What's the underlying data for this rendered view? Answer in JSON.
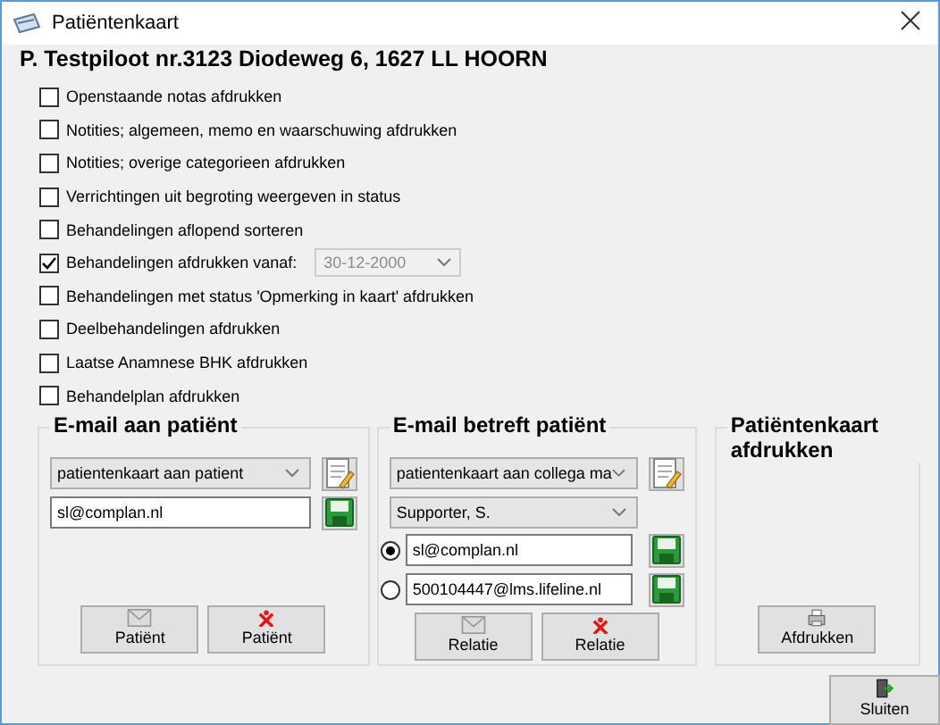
{
  "window": {
    "title": "Patiëntenkaart"
  },
  "header": "P. Testpiloot nr.3123 Diodeweg 6, 1627 LL HOORN",
  "options": [
    {
      "label": "Openstaande notas afdrukken",
      "checked": false
    },
    {
      "label": "Notities; algemeen, memo en waarschuwing afdrukken",
      "checked": false
    },
    {
      "label": "Notities; overige categorieen afdrukken",
      "checked": false
    },
    {
      "label": "Verrichtingen uit begroting weergeven in status",
      "checked": false
    },
    {
      "label": "Behandelingen aflopend sorteren",
      "checked": false
    },
    {
      "label": "Behandelingen afdrukken vanaf:",
      "checked": true,
      "date": {
        "value": "30-12-2000",
        "disabled": true
      }
    },
    {
      "label": "Behandelingen met status 'Opmerking in kaart' afdrukken",
      "checked": false
    },
    {
      "label": "Deelbehandelingen afdrukken",
      "checked": false
    },
    {
      "label": "Laatse Anamnese BHK afdrukken",
      "checked": false
    },
    {
      "label": "Behandelplan afdrukken",
      "checked": false
    }
  ],
  "email_patient": {
    "title": "E-mail aan patiënt",
    "template": "patientenkaart aan patient",
    "address": "sl@complan.nl",
    "buttons": [
      {
        "label": "Patiënt",
        "kind": "mail"
      },
      {
        "label": "Patiënt",
        "kind": "delete"
      }
    ]
  },
  "email_relation": {
    "title": "E-mail betreft patiënt",
    "template": "patientenkaart aan collega ma",
    "relation": "Supporter, S.",
    "addresses": [
      {
        "value": "sl@complan.nl",
        "selected": true
      },
      {
        "value": "500104447@lms.lifeline.nl",
        "selected": false
      }
    ],
    "buttons": [
      {
        "label": "Relatie",
        "kind": "mail"
      },
      {
        "label": "Relatie",
        "kind": "delete"
      }
    ]
  },
  "print": {
    "title": "Patiëntenkaart afdrukken",
    "button": "Afdrukken"
  },
  "close_button": "Sluiten"
}
